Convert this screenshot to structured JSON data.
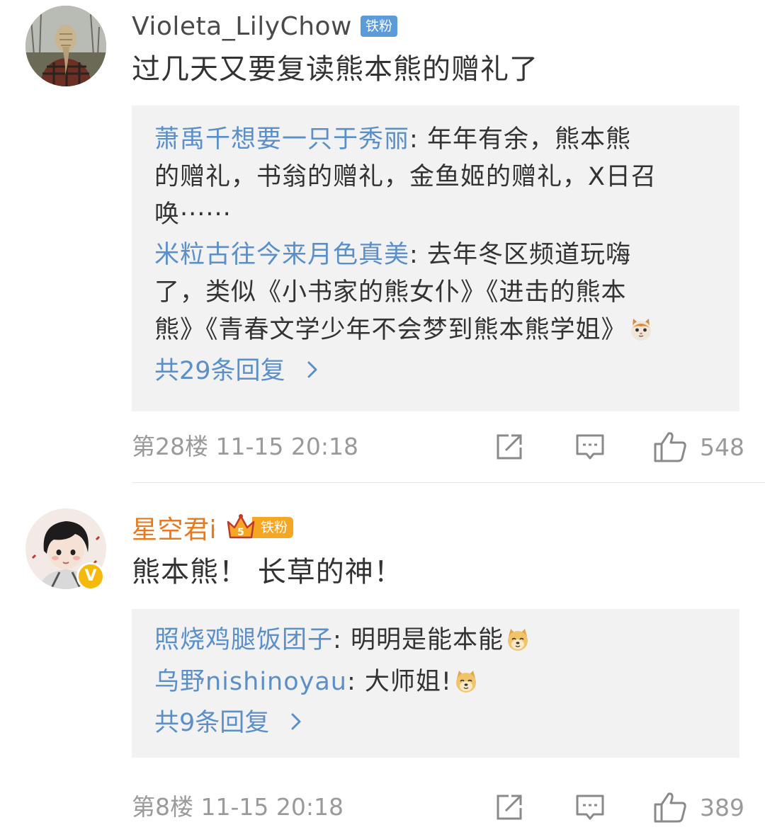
{
  "comments": [
    {
      "username": "Violeta_LilyChow",
      "fan_badge": "铁粉",
      "text": "过几天又要复读熊本熊的赠礼了",
      "replies": [
        {
          "author": "萧禹千想要一只于秀丽",
          "separator": ":",
          "line1": " 年年有余，熊本熊",
          "line2": "的赠礼，书翁的赠礼，金鱼姬的赠礼，X日召",
          "line3": "唤······"
        },
        {
          "author": "米粒古往今来月色真美",
          "separator": ":",
          "line1": " 去年冬区频道玩嗨",
          "line2": "了，类似《小书家的熊女仆》《进击的熊本",
          "line3": "熊》《青春文学少年不会梦到熊本熊学姐》",
          "emoji": "cat-emoji"
        }
      ],
      "more_replies": "共29条回复",
      "floor": "第28楼",
      "date": "11-15",
      "time": "20:18",
      "likes": "548"
    },
    {
      "username": "星空君i",
      "fan_badge": "铁粉",
      "fan_level": "5",
      "verified": "V",
      "text": "熊本熊！ 长草的神！",
      "replies": [
        {
          "author": "照烧鸡腿饭团子",
          "separator": ":",
          "text": " 明明是能本能",
          "emoji": "doge-emoji"
        },
        {
          "author": "乌野nishinoyau",
          "separator": ":",
          "text": " 大师姐!",
          "emoji": "doge-emoji"
        }
      ],
      "more_replies": "共9条回复",
      "floor": "第8楼",
      "date": "11-15",
      "time": "20:18",
      "likes": "389"
    }
  ],
  "colors": {
    "link_blue": "#5b8fc9",
    "gold_username": "#e8791d",
    "meta_gray": "#9a9a9a",
    "reply_bg": "#f2f2f2"
  },
  "icons": [
    "share-icon",
    "comment-icon",
    "like-icon",
    "chevron-right-icon",
    "cat-emoji",
    "doge-emoji",
    "crown-icon",
    "verified-badge"
  ]
}
